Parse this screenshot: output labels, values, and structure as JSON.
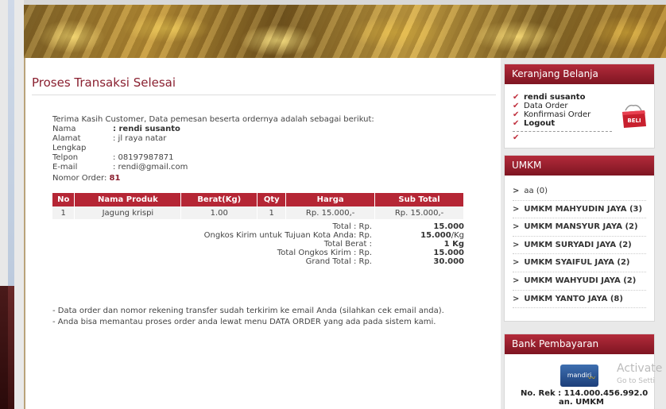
{
  "page": {
    "title": "Proses Transaksi Selesai",
    "intro": "Terima Kasih Customer, Data pemesan beserta ordernya adalah sebagai berikut:",
    "customer": [
      {
        "label": "Nama",
        "value": ": rendi susanto",
        "bold": true
      },
      {
        "label": "Alamat Lengkap",
        "value": ": jl raya natar",
        "bold": false
      },
      {
        "label": "Telpon",
        "value": ": 08197987871",
        "bold": false
      },
      {
        "label": "E-mail",
        "value": ": rendi@gmail.com",
        "bold": false
      }
    ],
    "order_label": "Nomor Order:",
    "order_number": "81",
    "table": {
      "headers": [
        "No",
        "Nama Produk",
        "Berat(Kg)",
        "Qty",
        "Harga",
        "Sub Total"
      ],
      "rows": [
        [
          "1",
          "Jagung krispi",
          "1.00",
          "1",
          "Rp. 15.000,-",
          "Rp. 15.000,-"
        ]
      ]
    },
    "totals": [
      {
        "label": "Total : Rp.",
        "value": "15.000",
        "unit": ""
      },
      {
        "label": "Ongkos Kirim untuk Tujuan Kota Anda: Rp.",
        "value": "15.000",
        "unit": "/Kg"
      },
      {
        "label": "Total Berat :",
        "value": "1 Kg",
        "unit": ""
      },
      {
        "label": "Total Ongkos Kirim : Rp.",
        "value": "15.000",
        "unit": ""
      },
      {
        "label": "Grand Total : Rp.",
        "value": "30.000",
        "unit": ""
      }
    ],
    "notes": [
      "- Data order dan nomor rekening transfer sudah terkirim ke email Anda (silahkan cek email anda).",
      "- Anda bisa memantau proses order anda lewat menu DATA ORDER yang ada pada sistem kami."
    ]
  },
  "sidebar": {
    "cart": {
      "title": "Keranjang Belanja",
      "items": [
        {
          "label": "rendi susanto",
          "bold": true
        },
        {
          "label": "Data Order",
          "bold": false
        },
        {
          "label": "Konfirmasi Order",
          "bold": false
        },
        {
          "label": "Logout",
          "bold": true
        }
      ],
      "bag_text": "BELI"
    },
    "umkm": {
      "title": "UMKM",
      "items": [
        "aa (0)",
        "UMKM MAHYUDIN JAYA (3)",
        "UMKM MANSYUR JAYA (2)",
        "UMKM SURYADI JAYA (2)",
        "UMKM SYAIFUL JAYA (2)",
        "UMKM WAHYUDI JAYA (2)",
        "UMKM YANTO JAYA (8)"
      ]
    },
    "bank": {
      "title": "Bank Pembayaran",
      "logo_text": "mandiri",
      "rek": "No. Rek : 114.000.456.992.0",
      "an": "an. UMKM"
    }
  },
  "watermark": {
    "line1": "Activate",
    "line2": "Go to Setti"
  },
  "colors": {
    "accent": "#b52635",
    "title": "#8a2030"
  }
}
